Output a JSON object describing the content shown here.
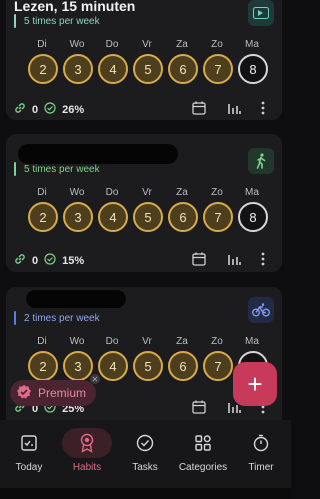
{
  "colors": {
    "accent": "#c73a5a",
    "done_border": "#d8aa4c",
    "green": "#54c56a",
    "blue": "#5b7de8"
  },
  "habits": [
    {
      "title": "Lezen, 15 minuten",
      "frequency": "5 times per week",
      "freq_color": "#8fd3c6",
      "icon": "ticket-icon",
      "days": [
        {
          "label": "Di",
          "num": "2",
          "state": "done"
        },
        {
          "label": "Wo",
          "num": "3",
          "state": "done"
        },
        {
          "label": "Do",
          "num": "4",
          "state": "done"
        },
        {
          "label": "Vr",
          "num": "5",
          "state": "done"
        },
        {
          "label": "Za",
          "num": "6",
          "state": "done"
        },
        {
          "label": "Zo",
          "num": "7",
          "state": "done"
        },
        {
          "label": "Ma",
          "num": "8",
          "state": "today"
        }
      ],
      "streak": "0",
      "percent": "26%"
    },
    {
      "title": "",
      "frequency": "5 times per week",
      "freq_color": "#7bd48a",
      "icon": "walking-icon",
      "days": [
        {
          "label": "Di",
          "num": "2",
          "state": "done"
        },
        {
          "label": "Wo",
          "num": "3",
          "state": "done"
        },
        {
          "label": "Do",
          "num": "4",
          "state": "done"
        },
        {
          "label": "Vr",
          "num": "5",
          "state": "done"
        },
        {
          "label": "Za",
          "num": "6",
          "state": "done"
        },
        {
          "label": "Zo",
          "num": "7",
          "state": "done"
        },
        {
          "label": "Ma",
          "num": "8",
          "state": "today"
        }
      ],
      "streak": "0",
      "percent": "15%"
    },
    {
      "title": "",
      "frequency": "2 times per week",
      "freq_color": "#8aa8f0",
      "icon": "bicycle-icon",
      "days": [
        {
          "label": "Di",
          "num": "2",
          "state": "done"
        },
        {
          "label": "Wo",
          "num": "3",
          "state": "done"
        },
        {
          "label": "Do",
          "num": "4",
          "state": "done"
        },
        {
          "label": "Vr",
          "num": "5",
          "state": "done"
        },
        {
          "label": "Za",
          "num": "6",
          "state": "done"
        },
        {
          "label": "Zo",
          "num": "7",
          "state": "done"
        },
        {
          "label": "Ma",
          "num": "",
          "state": "today"
        }
      ],
      "streak": "0",
      "percent": "25%"
    }
  ],
  "premium": {
    "label": "Premium"
  },
  "fab": {
    "label": "+"
  },
  "nav": [
    {
      "label": "Today",
      "icon": "today-icon"
    },
    {
      "label": "Habits",
      "icon": "award-icon"
    },
    {
      "label": "Tasks",
      "icon": "check-circle-icon"
    },
    {
      "label": "Categories",
      "icon": "categories-icon"
    },
    {
      "label": "Timer",
      "icon": "timer-icon"
    }
  ]
}
